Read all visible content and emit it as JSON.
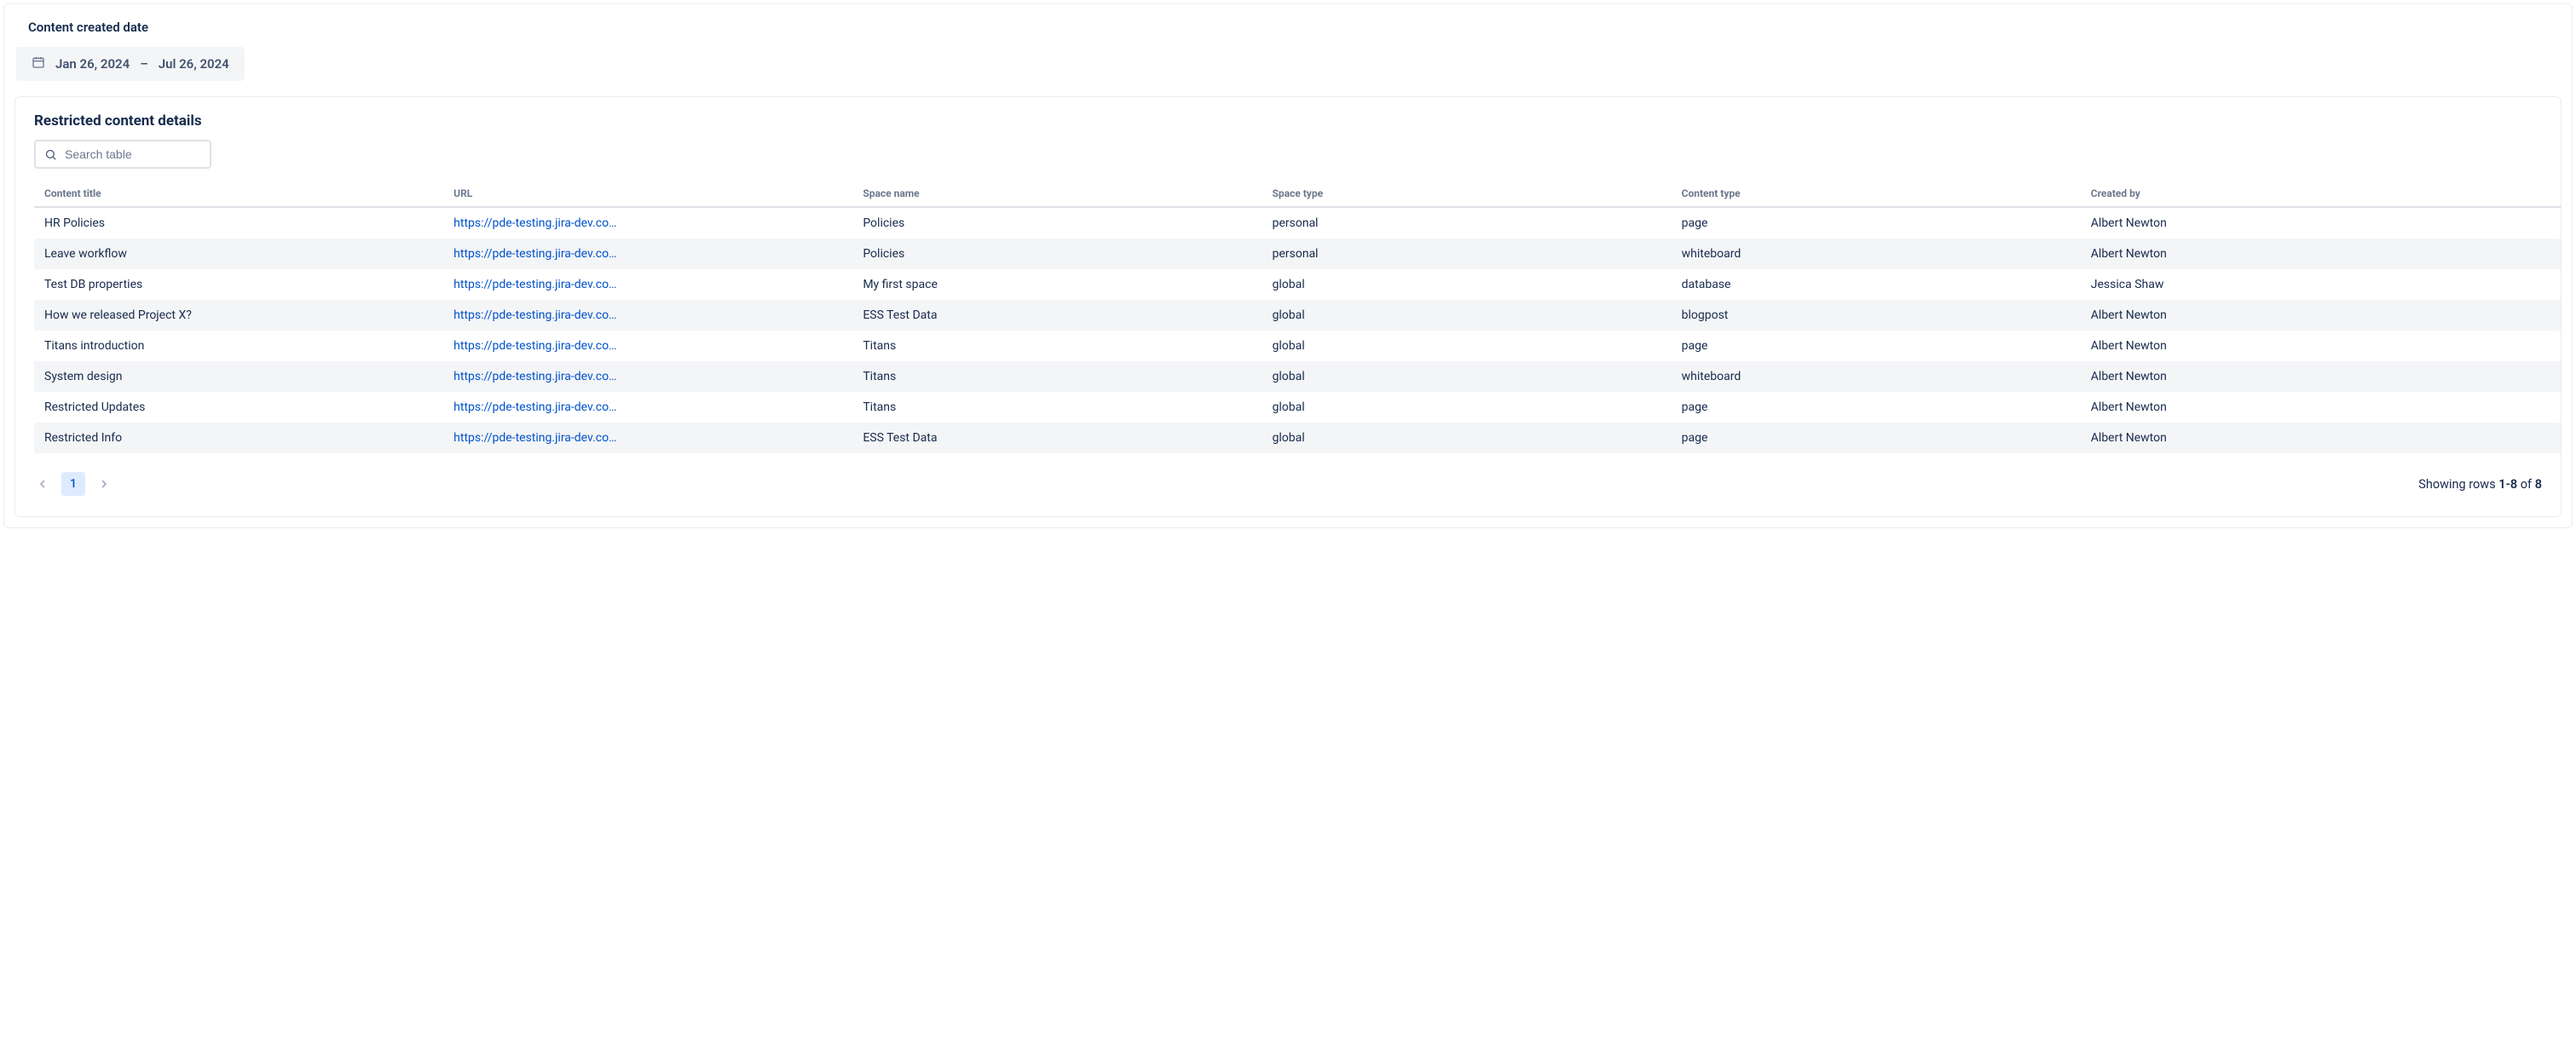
{
  "filter": {
    "label": "Content created date",
    "date_from": "Jan 26, 2024",
    "date_sep": "–",
    "date_to": "Jul 26, 2024"
  },
  "card": {
    "title": "Restricted content details",
    "search_placeholder": "Search table"
  },
  "columns": {
    "content_title": "Content title",
    "url": "URL",
    "space_name": "Space name",
    "space_type": "Space type",
    "content_type": "Content type",
    "created_by": "Created by"
  },
  "rows": [
    {
      "content_title": "HR Policies",
      "url": "https://pde-testing.jira-dev.co…",
      "space_name": "Policies",
      "space_type": "personal",
      "content_type": "page",
      "created_by": "Albert Newton"
    },
    {
      "content_title": "Leave workflow",
      "url": "https://pde-testing.jira-dev.co…",
      "space_name": "Policies",
      "space_type": "personal",
      "content_type": "whiteboard",
      "created_by": "Albert Newton"
    },
    {
      "content_title": "Test DB properties",
      "url": "https://pde-testing.jira-dev.co…",
      "space_name": "My first space",
      "space_type": "global",
      "content_type": "database",
      "created_by": "Jessica Shaw"
    },
    {
      "content_title": "How we released Project X?",
      "url": "https://pde-testing.jira-dev.co…",
      "space_name": "ESS Test Data",
      "space_type": "global",
      "content_type": "blogpost",
      "created_by": "Albert Newton"
    },
    {
      "content_title": "Titans introduction",
      "url": "https://pde-testing.jira-dev.co…",
      "space_name": "Titans",
      "space_type": "global",
      "content_type": "page",
      "created_by": "Albert Newton"
    },
    {
      "content_title": "System design",
      "url": "https://pde-testing.jira-dev.co…",
      "space_name": "Titans",
      "space_type": "global",
      "content_type": "whiteboard",
      "created_by": "Albert Newton"
    },
    {
      "content_title": "Restricted Updates",
      "url": "https://pde-testing.jira-dev.co…",
      "space_name": "Titans",
      "space_type": "global",
      "content_type": "page",
      "created_by": "Albert Newton"
    },
    {
      "content_title": "Restricted Info",
      "url": "https://pde-testing.jira-dev.co…",
      "space_name": "ESS Test Data",
      "space_type": "global",
      "content_type": "page",
      "created_by": "Albert Newton"
    }
  ],
  "pagination": {
    "current": "1",
    "showing_prefix": "Showing rows ",
    "range": "1-8",
    "of_word": " of ",
    "total": "8"
  }
}
